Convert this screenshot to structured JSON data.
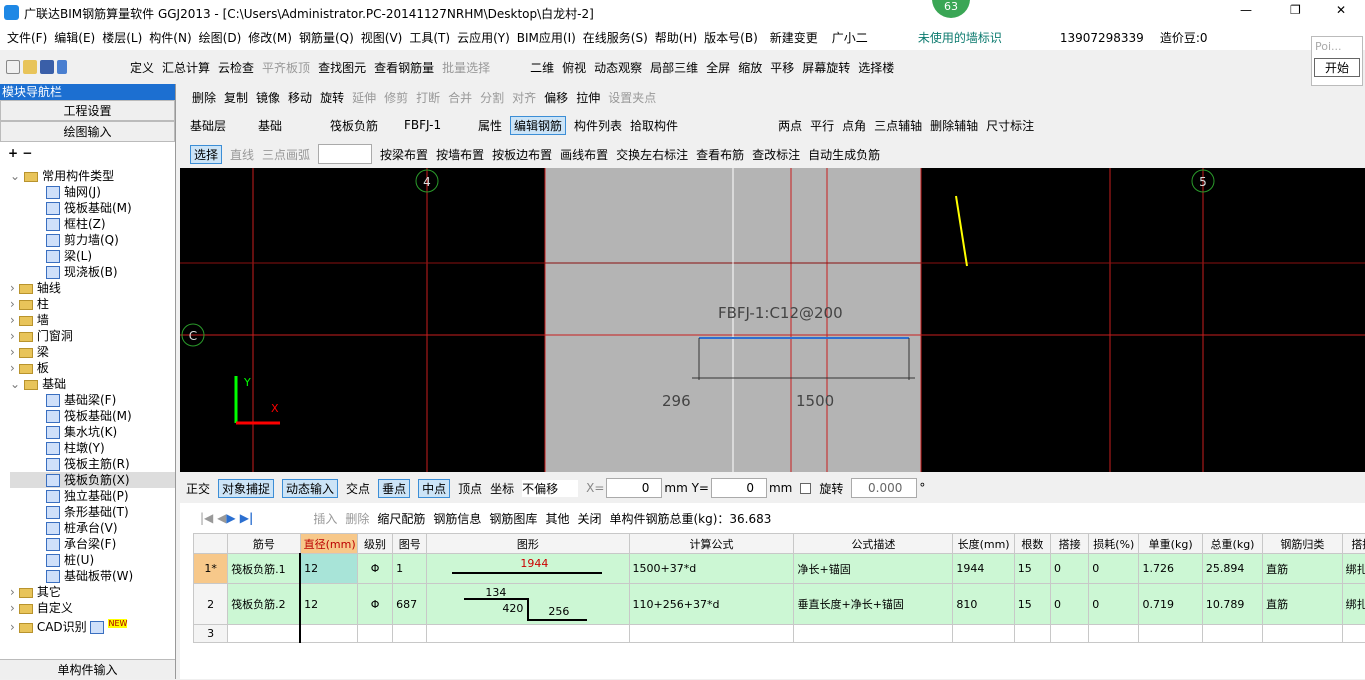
{
  "window": {
    "title": "广联达BIM钢筋算量软件 GGJ2013 - [C:\\Users\\Administrator.PC-20141127NRHM\\Desktop\\白龙村-2]",
    "badge": "63",
    "minimize": "—",
    "restore": "❐",
    "close": "✕",
    "ime_tip": "Poi...",
    "start_btn": "开始"
  },
  "menu": [
    "文件(F)",
    "编辑(E)",
    "楼层(L)",
    "构件(N)",
    "绘图(D)",
    "修改(M)",
    "钢筋量(Q)",
    "视图(V)",
    "工具(T)",
    "云应用(Y)",
    "BIM应用(I)",
    "在线服务(S)",
    "帮助(H)",
    "版本号(B)"
  ],
  "menu_right": {
    "new_change": "新建变更",
    "assistant": "广小二",
    "notice": "未使用的墙标识",
    "phone": "13907298339",
    "beans": "造价豆:0"
  },
  "toolbar1": [
    "定义",
    "汇总计算",
    "云检查",
    "平齐板顶",
    "查找图元",
    "查看钢筋量",
    "批量选择"
  ],
  "toolbar1b": [
    "二维",
    "俯视",
    "动态观察",
    "局部三维",
    "全屏",
    "缩放",
    "平移",
    "屏幕旋转",
    "选择楼"
  ],
  "toolbar2": [
    "删除",
    "复制",
    "镜像",
    "移动",
    "旋转",
    "延伸",
    "修剪",
    "打断",
    "合并",
    "分割",
    "对齐",
    "偏移",
    "拉伸",
    "设置夹点"
  ],
  "toolbar3": {
    "floor": "基础层",
    "type": "基础",
    "component": "筏板负筋",
    "name": "FBFJ-1",
    "items": [
      "属性",
      "编辑钢筋",
      "构件列表",
      "拾取构件"
    ]
  },
  "toolbar3b": [
    "两点",
    "平行",
    "点角",
    "三点辅轴",
    "删除辅轴",
    "尺寸标注"
  ],
  "toolbar4": [
    "选择",
    "直线",
    "三点画弧",
    "按梁布置",
    "按墙布置",
    "按板边布置",
    "画线布置",
    "交换左右标注",
    "查看布筋",
    "查改标注",
    "自动生成负筋"
  ],
  "sidebar": {
    "title": "模块导航栏",
    "btn1": "工程设置",
    "btn2": "绘图输入",
    "bottom": "单构件输入",
    "tree": [
      {
        "label": "常用构件类型",
        "open": true,
        "children": [
          "轴网(J)",
          "筏板基础(M)",
          "框柱(Z)",
          "剪力墙(Q)",
          "梁(L)",
          "现浇板(B)"
        ]
      },
      {
        "label": "轴线"
      },
      {
        "label": "柱"
      },
      {
        "label": "墙"
      },
      {
        "label": "门窗洞"
      },
      {
        "label": "梁"
      },
      {
        "label": "板"
      },
      {
        "label": "基础",
        "open": true,
        "children": [
          "基础梁(F)",
          "筏板基础(M)",
          "集水坑(K)",
          "柱墩(Y)",
          "筏板主筋(R)",
          "筏板负筋(X)",
          "独立基础(P)",
          "条形基础(T)",
          "桩承台(V)",
          "承台梁(F)",
          "桩(U)",
          "基础板带(W)"
        ]
      },
      {
        "label": "其它"
      },
      {
        "label": "自定义"
      },
      {
        "label": "CAD识别",
        "badge": "NEW"
      }
    ],
    "selected": "筏板负筋(X)"
  },
  "canvas": {
    "axis_4": "4",
    "axis_5": "5",
    "axis_c": "C",
    "label": "FBFJ-1:C12@200",
    "dim1": "296",
    "dim2": "1500",
    "x_axis": "X",
    "y_axis": "Y",
    "colors": {
      "bg": "#000000",
      "slab": "#b4b4b4",
      "grid": "#c81e1e",
      "rebar": "#2e6fd0"
    }
  },
  "snapbar": {
    "items": [
      "正交",
      "对象捕捉",
      "动态输入",
      "交点",
      "垂点",
      "中点",
      "顶点",
      "坐标"
    ],
    "offset": "不偏移",
    "x_label": "X=",
    "x": "0",
    "y_label": "mm Y=",
    "y": "0",
    "mm": "mm",
    "rotate": "旋转",
    "angle": "0.000",
    "deg": "°"
  },
  "rebar_toolbar": {
    "items": [
      "插入",
      "删除",
      "缩尺配筋",
      "钢筋信息",
      "钢筋图库",
      "其他",
      "关闭"
    ],
    "total": "单构件钢筋总重(kg)：36.683"
  },
  "table": {
    "headers": [
      "",
      "筋号",
      "直径(mm)",
      "级别",
      "图号",
      "图形",
      "计算公式",
      "公式描述",
      "长度(mm)",
      "根数",
      "搭接",
      "损耗(%)",
      "单重(kg)",
      "总重(kg)",
      "钢筋归类",
      "搭接"
    ],
    "rows": [
      {
        "no": "1*",
        "name": "筏板负筋.1",
        "dia": "12",
        "grade": "Φ",
        "fig": "1",
        "shape": [
          "1944"
        ],
        "formula": "1500+37*d",
        "desc": "净长+锚固",
        "len": "1944",
        "count": "15",
        "lap": "0",
        "loss": "0",
        "unit": "1.726",
        "total": "25.894",
        "cat": "直筋",
        "lap2": "绑扎"
      },
      {
        "no": "2",
        "name": "筏板负筋.2",
        "dia": "12",
        "grade": "Φ",
        "fig": "687",
        "shape": [
          "134",
          "420",
          "256"
        ],
        "formula": "110+256+37*d",
        "desc": "垂直长度+净长+锚固",
        "len": "810",
        "count": "15",
        "lap": "0",
        "loss": "0",
        "unit": "0.719",
        "total": "10.789",
        "cat": "直筋",
        "lap2": "绑扎"
      },
      {
        "no": "3"
      }
    ]
  }
}
